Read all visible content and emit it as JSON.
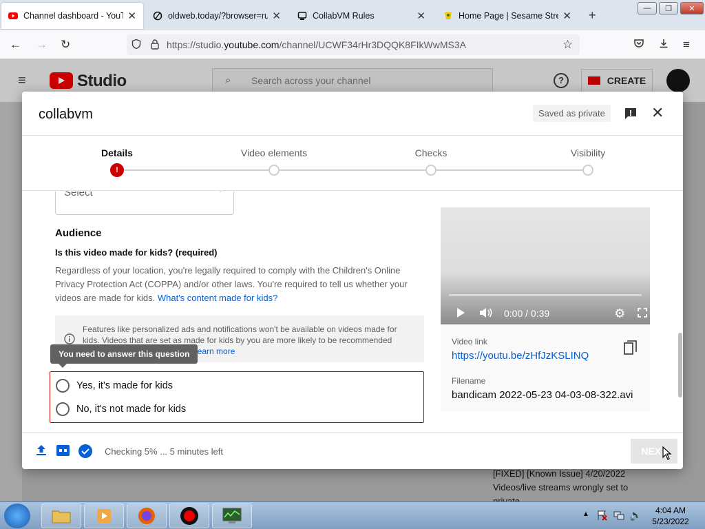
{
  "browser": {
    "tabs": [
      {
        "title": "Channel dashboard - YouTube",
        "active": true
      },
      {
        "title": "oldweb.today/?browser=ruffle",
        "active": false
      },
      {
        "title": "CollabVM Rules",
        "active": false
      },
      {
        "title": "Home Page | Sesame Street",
        "active": false
      }
    ],
    "url_prefix": "https://studio.",
    "url_domain": "youtube.com",
    "url_path": "/channel/UCWF34rHr3DQQK8FIkWwMS3A"
  },
  "studio": {
    "logo": "Studio",
    "search_placeholder": "Search across your channel",
    "create_label": "CREATE",
    "bg_text_1": "[FIXED] [Known Issue] 4/20/2022",
    "bg_text_2": "Videos/live streams wrongly set to",
    "bg_text_3": "private"
  },
  "dialog": {
    "title": "collabvm",
    "saved_label": "Saved as private",
    "steps": [
      {
        "label": "Details"
      },
      {
        "label": "Video elements"
      },
      {
        "label": "Checks"
      },
      {
        "label": "Visibility"
      }
    ],
    "select_value": "Select",
    "audience_title": "Audience",
    "audience_question": "Is this video made for kids? (required)",
    "audience_desc": "Regardless of your location, you're legally required to comply with the Children's Online Privacy Protection Act (COPPA) and/or other laws. You're required to tell us whether your videos are made for kids.",
    "audience_link": "What's content made for kids?",
    "info_text": "Features like personalized ads and notifications won't be available on videos made for kids. Videos that are set as made for kids by you are more likely to be recommended",
    "info_link": "Learn more",
    "tooltip": "You need to answer this question",
    "radio_yes": "Yes, it's made for kids",
    "radio_no": "No, it's not made for kids",
    "video_time": "0:00 / 0:39",
    "video_link_label": "Video link",
    "video_link": "https://youtu.be/zHfJzKSLINQ",
    "filename_label": "Filename",
    "filename": "bandicam 2022-05-23 04-03-08-322.avi",
    "status": "Checking 5% ... 5 minutes left",
    "next_label": "NEXT"
  },
  "taskbar": {
    "time": "4:04 AM",
    "date": "5/23/2022"
  },
  "colors": {
    "yt_red": "#ff0000",
    "error_red": "#cc0000",
    "link_blue": "#065fd4"
  }
}
